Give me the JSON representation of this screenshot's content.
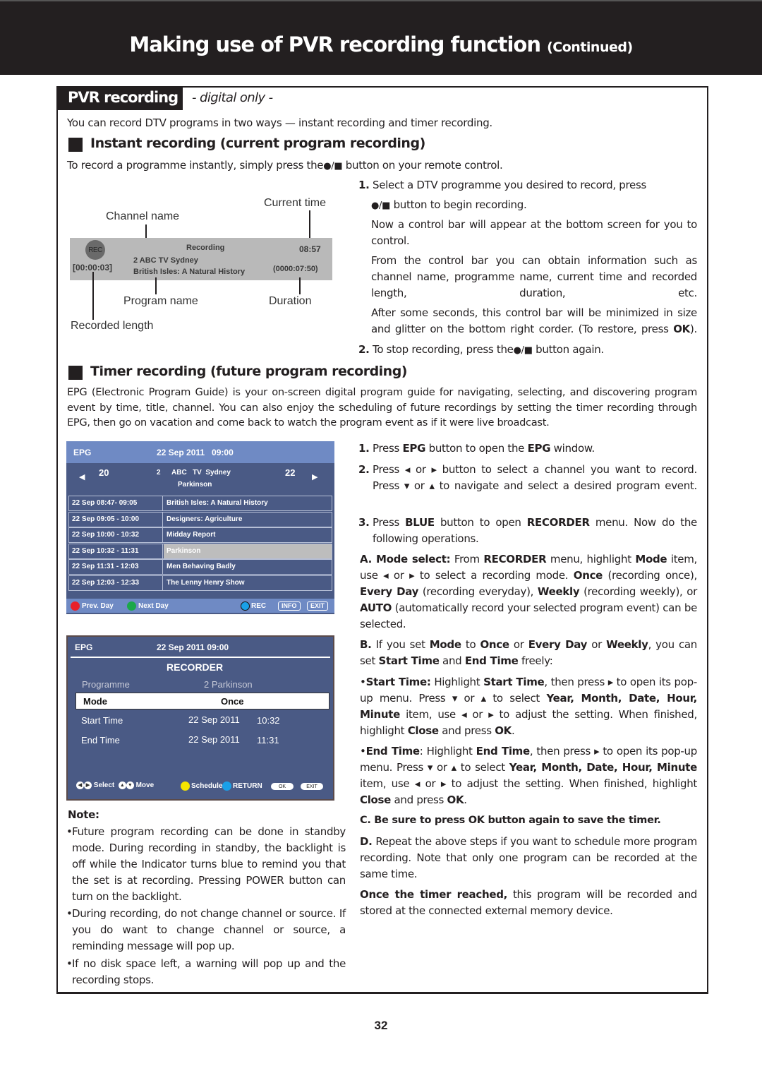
{
  "header": {
    "title": "Making use of PVR recording function",
    "title_suffix": "(Continued)"
  },
  "section": {
    "tag": "PVR recording",
    "subtitle": "- digital only -",
    "intro": "You can record DTV programs in two ways — instant recording and timer recording."
  },
  "instant": {
    "heading": "Instant recording (current program recording)",
    "lead_before": "To record a programme instantly, simply press the",
    "lead_symbol": "●/■",
    "lead_after": "button on your remote control.",
    "diagram": {
      "labels": {
        "channel_name": "Channel name",
        "current_time": "Current time",
        "program_name": "Program name",
        "duration": "Duration",
        "recorded_length": "Recorded length"
      },
      "bar": {
        "rec_badge": "REC",
        "status": "Recording",
        "channel": "2 ABC TV Sydney",
        "program": "British Isles: A Natural History",
        "time": "08:57",
        "recorded": "[00:00:03]",
        "duration": "(0000:07:50)"
      }
    },
    "steps": {
      "s1_num": "1.",
      "s1_line1": "Select a DTV programme you desired to record, press",
      "s1_symbol": "●/■",
      "s1_line2": "button to begin recording.",
      "p1": "Now a control bar will appear at the bottom screen for you to control.",
      "p2": "From the control bar you can obtain information such as channel name, programme name, current time and recorded length, duration, etc.",
      "p3_before": "After some seconds, this control bar will be minimized in size and glitter on the bottom right corder. (To restore, press",
      "p3_bold": "OK",
      "p3_after": ").",
      "s2_num": "2.",
      "s2_before": "To stop recording, press the",
      "s2_symbol": "●/■",
      "s2_after": "button again."
    }
  },
  "timer": {
    "heading": "Timer recording (future program recording)",
    "intro": "EPG (Electronic Program Guide) is your on-screen digital program guide for navigating, selecting, and discovering program event by time, title, channel. You can also enjoy the scheduling of future recordings by setting the timer recording through EPG, then go on vacation and come back to watch the program event as if it were live broadcast.",
    "epg": {
      "title": "EPG",
      "datetime": "22 Sep 2011   09:00",
      "prev_channel": "20",
      "next_channel": "22",
      "channel_num": "2",
      "channel_name": "ABC   TV  Sydney",
      "program": "Parkinson",
      "rows": [
        {
          "time": "22 Sep  08:47- 09:05",
          "title": "British Isles: A Natural History",
          "selected": false
        },
        {
          "time": "22 Sep  09:05 - 10:00",
          "title": "Designers: Agriculture",
          "selected": false
        },
        {
          "time": "22 Sep  10:00 - 10:32",
          "title": "Midday Report",
          "selected": false
        },
        {
          "time": "22 Sep  10:32 - 11:31",
          "title": "Parkinson",
          "selected": true
        },
        {
          "time": "22 Sep  11:31 - 12:03",
          "title": "Men Behaving Badly",
          "selected": false
        },
        {
          "time": "22 Sep  12:03 - 12:33",
          "title": "The Lenny Henry Show",
          "selected": false
        }
      ],
      "footer": {
        "prev_day": "Prev. Day",
        "next_day": "Next Day",
        "rec": "REC",
        "info": "INFO",
        "exit": "EXIT"
      },
      "colors": {
        "red": "#e8202a",
        "green": "#1aa84a",
        "blue": "#1aa0e8",
        "yellow": "#f5e600"
      }
    },
    "recorder": {
      "epg_label": "EPG",
      "datetime": "22 Sep 2011 09:00",
      "title": "RECORDER",
      "programme_label": "Programme",
      "programme_value": "2 Parkinson",
      "mode_label": "Mode",
      "mode_value": "Once",
      "start_label": "Start Time",
      "start_date": "22 Sep 2011",
      "start_time": "10:32",
      "end_label": "End Time",
      "end_date": "22 Sep 2011",
      "end_time": "11:31",
      "footer": {
        "select": "Select",
        "move": "Move",
        "schedule": "Schedule",
        "return": "RETURN",
        "ok": "OK",
        "exit": "EXIT"
      }
    },
    "note": {
      "title": "Note:",
      "items": [
        "Future program recording can be done in standby mode. During recording in standby, the backlight is off while the Indicator turns blue to remind you that the set is at recording. Pressing POWER button can turn on the backlight.",
        "During recording, do not change channel or source. If you do want to change channel or source, a reminding message will pop up.",
        "If no disk space left, a warning will pop up and the recording stops."
      ]
    },
    "steps": {
      "s1": {
        "num": "1.",
        "a": "Press ",
        "b1": "EPG",
        "c": " button to open the ",
        "b2": "EPG",
        "d": " window."
      },
      "s2": {
        "num": "2.",
        "a": "Press ◂ or ▸ button to select a channel you want to record. Press ▾ or ▴ to navigate and select a desired program event."
      },
      "s3": {
        "num": "3.",
        "a": "Press ",
        "b1": "BLUE",
        "c": " button to open ",
        "b2": "RECORDER",
        "d": " menu. Now do the following operations."
      },
      "A": {
        "label": "A. Mode select:",
        "a": " From ",
        "b1": "RECORDER",
        "c": " menu, highlight ",
        "b2": "Mode",
        "d": " item, use ◂ or ▸ to select a recording mode. ",
        "b3": "Once",
        "e": " (recording once), ",
        "b4": "Every Day",
        "f": " (recording everyday), ",
        "b5": "Weekly",
        "g": " (recording weekly), or ",
        "b6": "AUTO",
        "h": " (automatically record your selected program event) can be selected."
      },
      "B": {
        "label": "B.",
        "a": " If you set ",
        "b1": "Mode",
        "c": " to ",
        "b2": "Once",
        "d": " or ",
        "b3": "Every Day",
        "e": " or ",
        "b4": "Weekly",
        "f": ", you can set ",
        "b5": "Start Time",
        "g": " and ",
        "b6": "End Time",
        "h": " freely:"
      },
      "start": {
        "label": "Start Time:",
        "a": " Highlight ",
        "b1": "Start Time",
        "c": ", then press ▸ to open its pop-up menu. Press ▾ or ▴ to select ",
        "b2": "Year, Month, Date, Hour, Minute",
        "d": " item, use ◂ or ▸ to adjust the setting. When finished, highlight ",
        "b3": "Close",
        "e": " and press ",
        "b4": "OK",
        "f": "."
      },
      "end": {
        "label": "End Time",
        "a": ": Highlight ",
        "b1": "End Time",
        "c": ", then press ▸ to open its pop-up menu. Press ▾ or ▴ to select ",
        "b2": "Year, Month, Date, Hour, Minute",
        "d": " item, use ◂ or ▸ to adjust the setting. When finished, highlight ",
        "b3": "Close",
        "e": " and press ",
        "b4": "OK",
        "f": "."
      },
      "C": "C. Be sure to press OK button again to save the timer.",
      "D": {
        "label": "D.",
        "a": " Repeat the above steps if you want to schedule more program recording. Note that only one program can be recorded at the same time."
      },
      "final": {
        "b": "Once the timer reached,",
        "a": " this program will be recorded and stored at the connected external memory device."
      }
    }
  },
  "footer": {
    "page_number": "32"
  }
}
